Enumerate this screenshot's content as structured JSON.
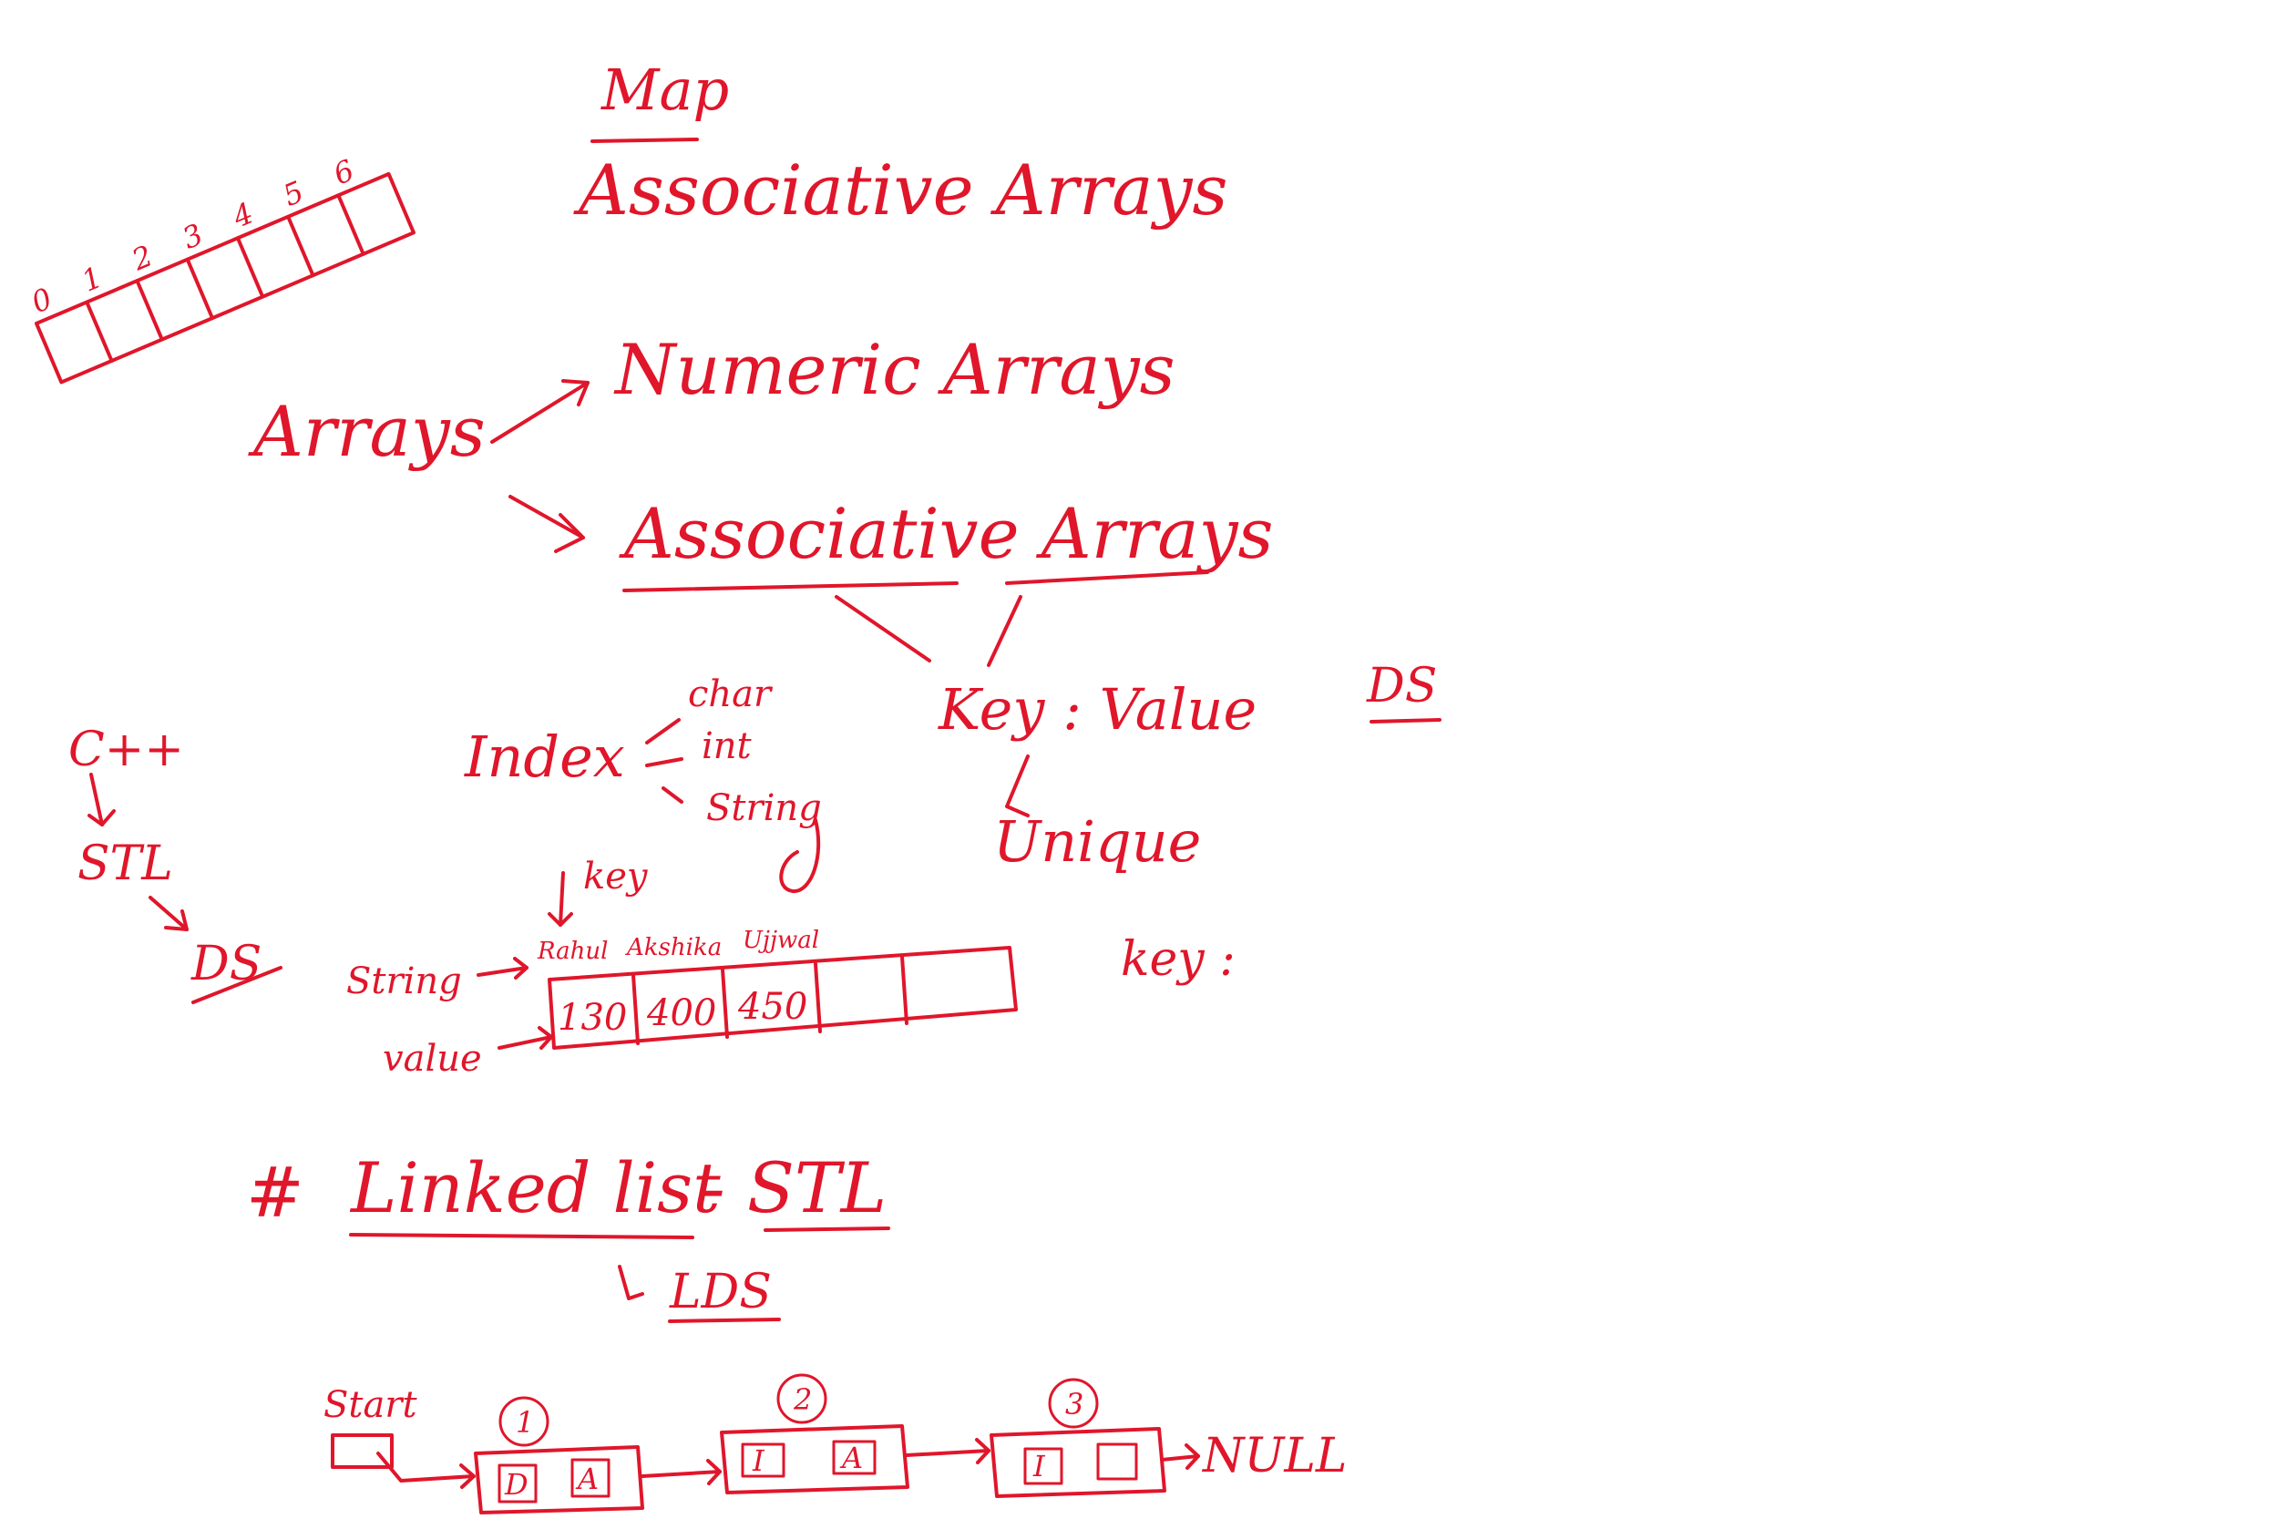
{
  "colors": {
    "ink": "#e0162b",
    "background": "#ffffff"
  },
  "top": {
    "map": "Map",
    "associative_arrays_top": "Associative Arrays"
  },
  "array_indices": [
    "0",
    "1",
    "2",
    "3",
    "4",
    "5",
    "6"
  ],
  "arrays_tree": {
    "root": "Arrays",
    "branch_numeric": "Numeric Arrays",
    "branch_associative": "Associative Arrays",
    "key_value": "Key : Value",
    "unique": "Unique",
    "ds_right": "DS"
  },
  "index_types": {
    "label": "Index",
    "types": [
      "char",
      "int",
      "String"
    ]
  },
  "cpp_chain": {
    "cpp": "C++",
    "stl": "STL",
    "ds": "DS"
  },
  "assoc_table": {
    "key_label": "key",
    "string_label": "String",
    "value_label": "value",
    "keys": [
      "Rahul",
      "Akshika",
      "Ujjwal"
    ],
    "values": [
      "130",
      "400",
      "450"
    ],
    "side_key": "key :"
  },
  "linked_list_title": {
    "hash": "#",
    "title": "Linked list",
    "dash_stl": "- STL",
    "lds": "LDS"
  },
  "linked_list_diagram": {
    "start_label": "Start",
    "null_label": "NULL",
    "nodes": [
      {
        "number": "1",
        "data": "D",
        "addr": "A"
      },
      {
        "number": "2",
        "data": "I",
        "addr": "A"
      },
      {
        "number": "3",
        "data": "I",
        "addr": ""
      }
    ]
  }
}
